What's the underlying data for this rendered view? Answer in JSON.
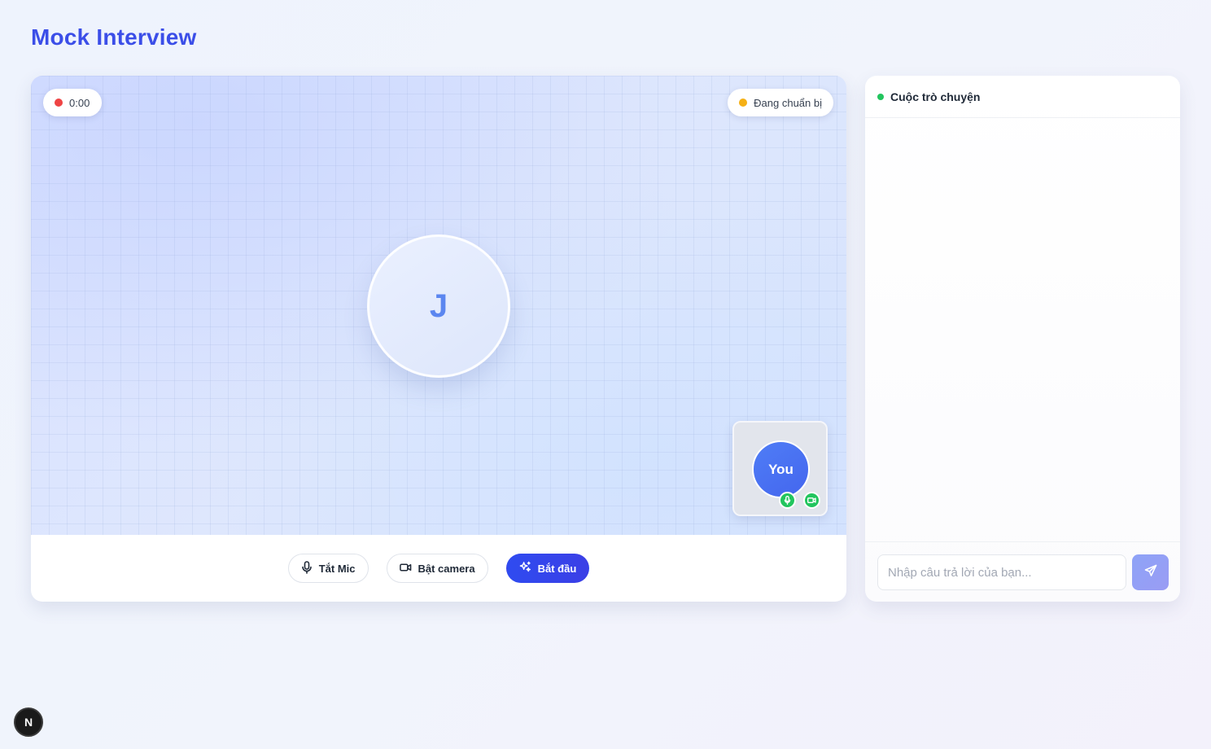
{
  "page": {
    "title": "Mock Interview"
  },
  "video": {
    "timer": "0:00",
    "status": "Đang chuẩn bị",
    "interviewer_initial": "J",
    "self_label": "You"
  },
  "controls": {
    "mic_label": "Tắt Mic",
    "camera_label": "Bật camera",
    "start_label": "Bắt đầu"
  },
  "chat": {
    "title": "Cuộc trò chuyện",
    "input_placeholder": "Nhập câu trả lời của bạn...",
    "input_value": ""
  },
  "devtools": {
    "badge": "N"
  },
  "colors": {
    "accent": "#3b4ee8",
    "recording_dot": "#ef4444",
    "status_dot": "#f59e0b",
    "online_dot": "#22c55e",
    "primary_button": "#2f4bf0"
  },
  "icons": {
    "mic": "microphone-icon",
    "camera": "video-camera-icon",
    "start": "sparkles-icon",
    "send": "send-icon"
  }
}
